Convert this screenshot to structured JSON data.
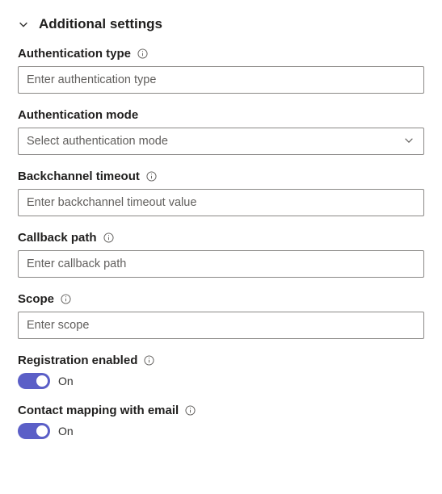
{
  "section": {
    "title": "Additional settings"
  },
  "fields": {
    "auth_type": {
      "label": "Authentication type",
      "placeholder": "Enter authentication type"
    },
    "auth_mode": {
      "label": "Authentication mode",
      "placeholder": "Select authentication mode"
    },
    "backchannel_timeout": {
      "label": "Backchannel timeout",
      "placeholder": "Enter backchannel timeout value"
    },
    "callback_path": {
      "label": "Callback path",
      "placeholder": "Enter callback path"
    },
    "scope": {
      "label": "Scope",
      "placeholder": "Enter scope"
    },
    "registration_enabled": {
      "label": "Registration enabled",
      "state": "On"
    },
    "contact_mapping": {
      "label": "Contact mapping with email",
      "state": "On"
    }
  }
}
